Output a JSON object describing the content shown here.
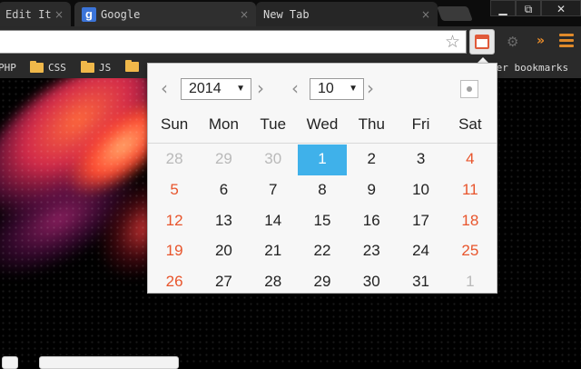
{
  "tabs": [
    {
      "label": "Edit It",
      "close": "×"
    },
    {
      "label": "Google",
      "icon": "google-g-icon",
      "icon_text": "g",
      "close": "×"
    },
    {
      "label": "New Tab",
      "close": "×"
    }
  ],
  "window_controls": {
    "minimize": "▁",
    "maximize": "⧉",
    "close": "✕"
  },
  "toolbar": {
    "url": "",
    "star": "☆",
    "extension_icons": [
      "calendar-icon",
      "gear-icon"
    ],
    "overflow": "»",
    "menu_icon": "menu-icon"
  },
  "bookmarks": [
    {
      "label": "PHP"
    },
    {
      "label": "CSS",
      "icon": "folder-icon"
    },
    {
      "label": "JS",
      "icon": "folder-icon"
    },
    {
      "label": "",
      "icon": "folder-icon"
    },
    {
      "label": "her bookmarks"
    }
  ],
  "calendar": {
    "nav": {
      "prev": "‹",
      "next": "›"
    },
    "year": "2014",
    "month": "10",
    "dropdown_glyph": "▼",
    "weekdays": [
      "Sun",
      "Mon",
      "Tue",
      "Wed",
      "Thu",
      "Fri",
      "Sat"
    ],
    "weeks": [
      [
        "28",
        "29",
        "30",
        "1",
        "2",
        "3",
        "4"
      ],
      [
        "5",
        "6",
        "7",
        "8",
        "9",
        "10",
        "11"
      ],
      [
        "12",
        "13",
        "14",
        "15",
        "16",
        "17",
        "18"
      ],
      [
        "19",
        "20",
        "21",
        "22",
        "23",
        "24",
        "25"
      ],
      [
        "26",
        "27",
        "28",
        "29",
        "30",
        "31",
        "1"
      ]
    ],
    "selected_day": "1",
    "colors": {
      "selected": "#3fb1ea",
      "weekend": "#e8552c",
      "other_month": "#b9b9b9"
    }
  }
}
